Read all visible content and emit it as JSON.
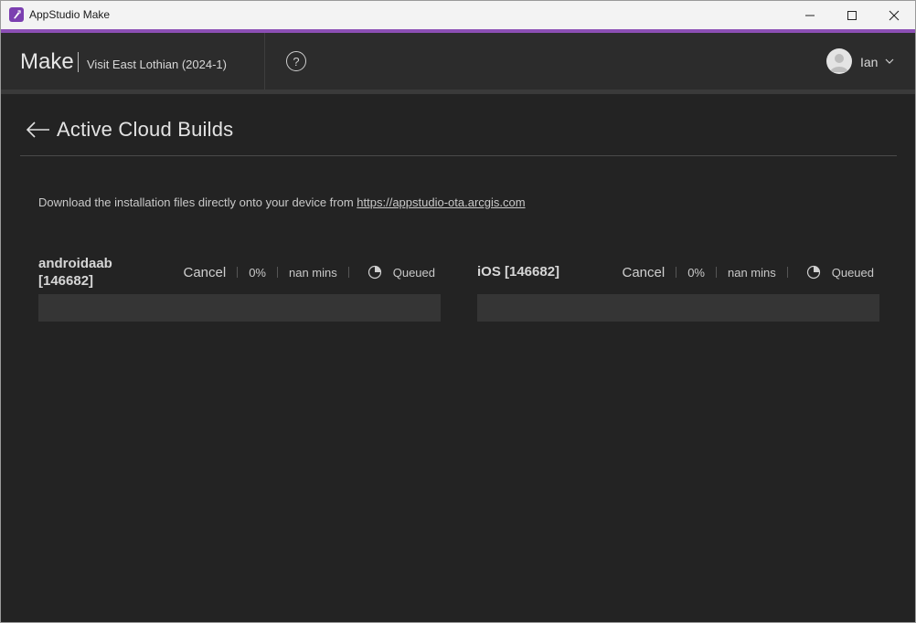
{
  "window": {
    "title": "AppStudio Make"
  },
  "header": {
    "brand": "Make",
    "project": "Visit East Lothian (2024-1)",
    "user": "Ian",
    "help_glyph": "?"
  },
  "page": {
    "title": "Active Cloud Builds",
    "info_text": "Download the installation files directly onto your device from ",
    "info_link": "https://appstudio-ota.arcgis.com"
  },
  "builds": [
    {
      "name_line1": "androidaab",
      "name_line2": "[146682]",
      "cancel": "Cancel",
      "percent": "0%",
      "eta": "nan mins",
      "status": "Queued",
      "progress": 0
    },
    {
      "name_line1": "iOS [146682]",
      "name_line2": "",
      "cancel": "Cancel",
      "percent": "0%",
      "eta": "nan mins",
      "status": "Queued",
      "progress": 0
    }
  ],
  "icons": [
    "app-icon",
    "minimize-icon",
    "maximize-icon",
    "close-icon",
    "help-icon",
    "avatar-icon",
    "chevron-down-icon",
    "back-arrow-icon",
    "queued-clock-icon"
  ],
  "colors": {
    "accent": "#8c4fb5",
    "background": "#232323",
    "header": "#2c2c2c"
  }
}
